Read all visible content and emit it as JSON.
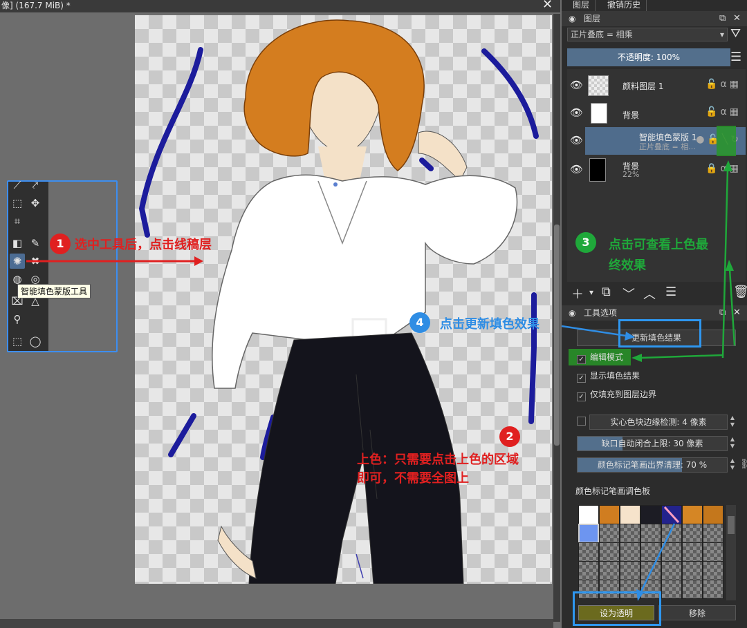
{
  "window": {
    "title": "像] (167.7 MiB) *",
    "close": "✕"
  },
  "dock": {
    "tabs": [
      "图层",
      "撤销历史"
    ],
    "layers_panel": {
      "title": "图层",
      "blend_mode": "正片叠底 = 相乘",
      "opacity_label": "不透明度: 100%",
      "layers": [
        {
          "name": "颜料图层 1",
          "sub": "",
          "thumb": "checker",
          "selected": false
        },
        {
          "name": "背景",
          "sub": "",
          "thumb": "sketch",
          "selected": false
        },
        {
          "name": "智能填色蒙版 1",
          "sub": "正片叠底 = 相...",
          "thumb": "none",
          "selected": true
        },
        {
          "name": "背景",
          "sub": "22%",
          "thumb": "black",
          "selected": false
        }
      ]
    },
    "tool_options": {
      "title": "工具选项",
      "update_button": "更新填色结果",
      "checkboxes": [
        {
          "label": "编辑模式",
          "checked": true
        },
        {
          "label": "显示填色结果",
          "checked": true
        },
        {
          "label": "仅填充到图层边界",
          "checked": true
        }
      ],
      "sliders": [
        {
          "label": "实心色块边缘检测: 4 像素",
          "fill": 0.0
        },
        {
          "label": "缺口自动闭合上限: 30 像素",
          "fill": 0.3
        },
        {
          "label": "颜色标记笔画出界清理: 70 %",
          "fill": 0.7
        }
      ],
      "palette_label": "颜色标记笔画调色板",
      "palette_colors": [
        "#ffffff",
        "#d07d20",
        "#f6e3cb",
        "#1c1c24",
        "#23238c",
        "#d58625",
        "#c4771c"
      ],
      "set_transparent": "设为透明",
      "remove": "移除"
    }
  },
  "tooltip": "智能填色蒙版工具",
  "annotations": {
    "step1": {
      "num": "1",
      "text": "选中工具后，点击线稿层"
    },
    "step2": {
      "num": "2",
      "line1": "上色：只需要点击上色的区域",
      "line2": "即可，不需要全图上"
    },
    "step3": {
      "num": "3",
      "line1": "点击可查看上色最",
      "line2": "终效果"
    },
    "step4": {
      "num": "4",
      "text": "点击更新填色效果"
    }
  },
  "colors": {
    "accent_blue": "#3d8ef0",
    "badge_red": "#e02020",
    "badge_green": "#1fa83a",
    "badge_blue": "#2f8de4",
    "layer_selected": "#4f6c8c"
  }
}
